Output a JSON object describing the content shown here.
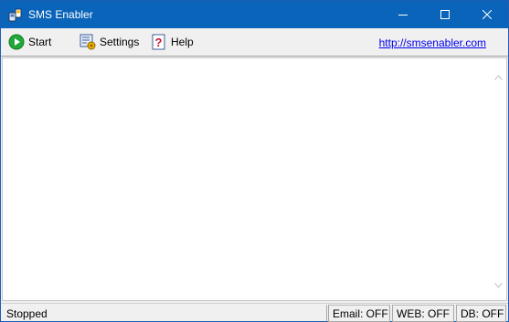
{
  "window": {
    "title": "SMS Enabler",
    "icon": "sms-phone-icon",
    "accent_color": "#0a64b9"
  },
  "toolbar": {
    "start_label": "Start",
    "settings_label": "Settings",
    "help_label": "Help",
    "website_link": "http://smsenabler.com"
  },
  "statusbar": {
    "status": "Stopped",
    "email": "Email: OFF",
    "web": "WEB: OFF",
    "db": "DB: OFF"
  }
}
